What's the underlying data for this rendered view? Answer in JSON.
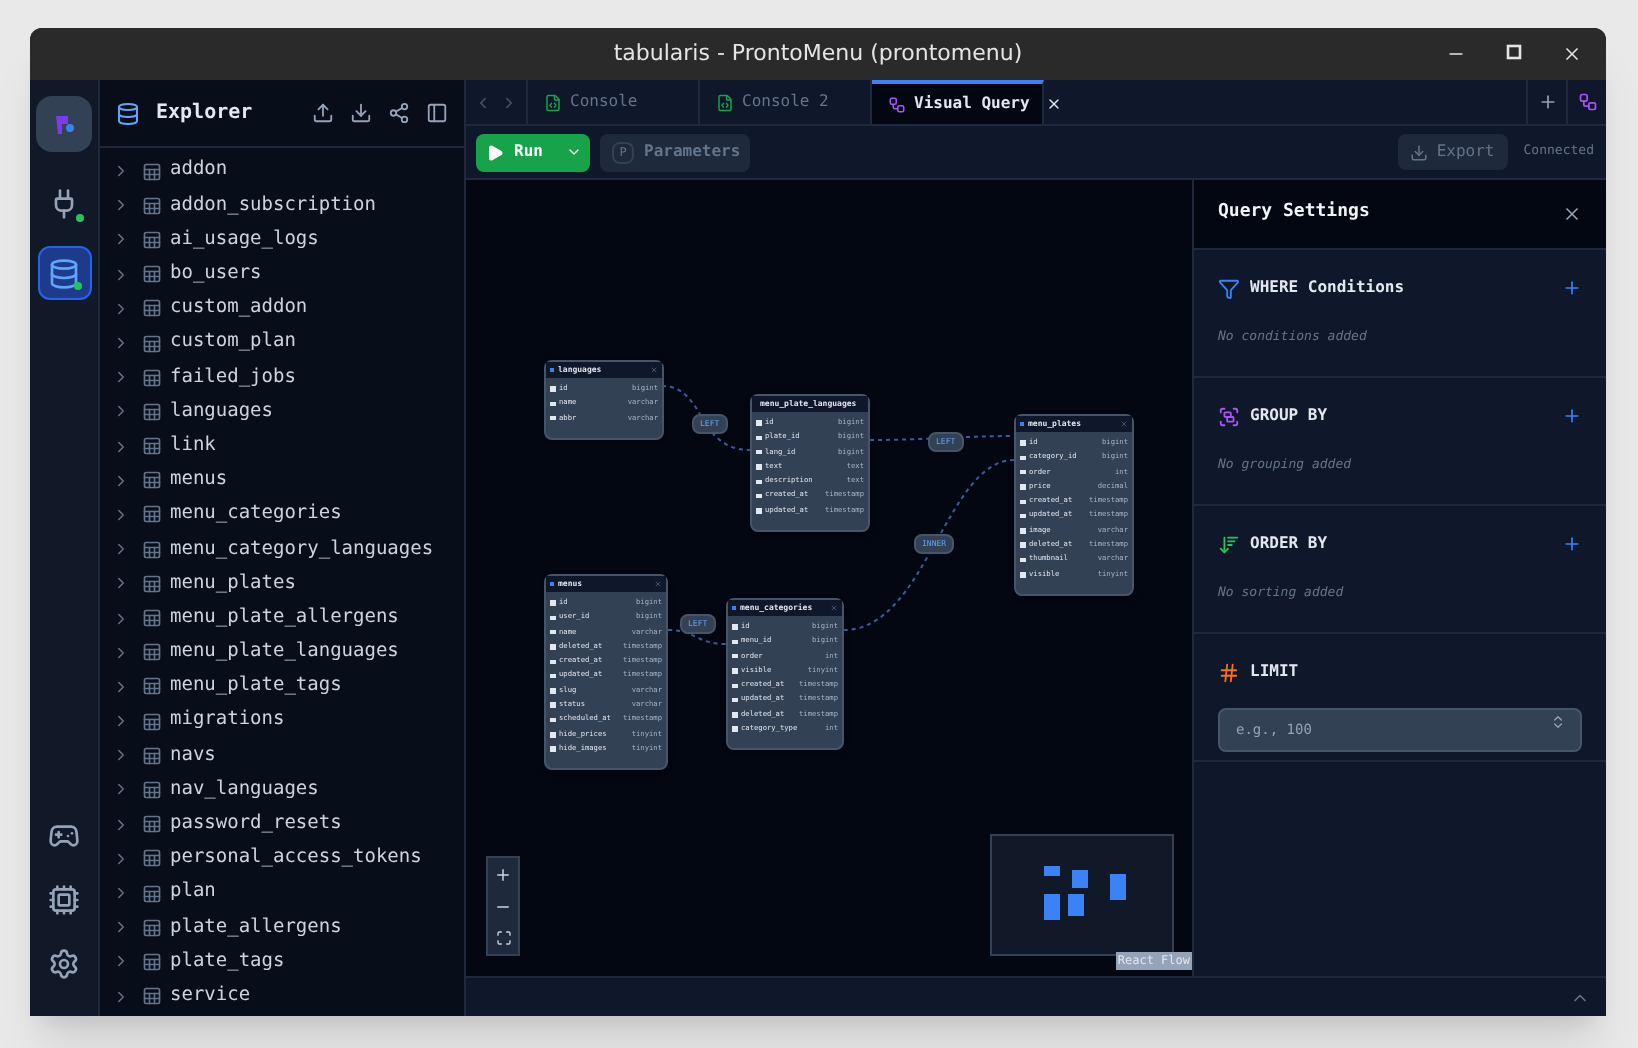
{
  "window": {
    "title": "tabularis - ProntoMenu (prontomenu)"
  },
  "rail": {
    "top": [
      {
        "kind": "connections",
        "selected": false
      },
      {
        "kind": "database",
        "selected": true
      }
    ],
    "bottom": [
      {
        "kind": "discord"
      },
      {
        "kind": "cpu"
      },
      {
        "kind": "settings"
      }
    ]
  },
  "explorer": {
    "title": "Explorer",
    "tables": [
      "addon",
      "addon_subscription",
      "ai_usage_logs",
      "bo_users",
      "custom_addon",
      "custom_plan",
      "failed_jobs",
      "languages",
      "link",
      "menus",
      "menu_categories",
      "menu_category_languages",
      "menu_plates",
      "menu_plate_allergens",
      "menu_plate_languages",
      "menu_plate_tags",
      "migrations",
      "navs",
      "nav_languages",
      "password_resets",
      "personal_access_tokens",
      "plan",
      "plate_allergens",
      "plate_tags",
      "service"
    ]
  },
  "tabs": [
    {
      "label": "Console",
      "kind": "console",
      "selected": false
    },
    {
      "label": "Console 2",
      "kind": "console",
      "selected": false
    },
    {
      "label": "Visual Query",
      "kind": "visual",
      "selected": true
    }
  ],
  "toolbar": {
    "run": "Run",
    "parameters_key": "P",
    "parameters": "Parameters",
    "export": "Export",
    "status": "Connected"
  },
  "diagram": {
    "nodes": [
      {
        "name": "languages",
        "columns": [
          {
            "name": "id",
            "type": "bigint"
          },
          {
            "name": "name",
            "type": "varchar"
          },
          {
            "name": "abbr",
            "type": "varchar"
          }
        ]
      },
      {
        "name": "menu_plate_languages",
        "columns": [
          {
            "name": "id",
            "type": "bigint"
          },
          {
            "name": "plate_id",
            "type": "bigint"
          },
          {
            "name": "lang_id",
            "type": "bigint"
          },
          {
            "name": "text",
            "type": "text"
          },
          {
            "name": "description",
            "type": "text"
          },
          {
            "name": "created_at",
            "type": "timestamp"
          },
          {
            "name": "updated_at",
            "type": "timestamp"
          }
        ]
      },
      {
        "name": "menu_plates",
        "columns": [
          {
            "name": "id",
            "type": "bigint"
          },
          {
            "name": "category_id",
            "type": "bigint"
          },
          {
            "name": "order",
            "type": "int"
          },
          {
            "name": "price",
            "type": "decimal"
          },
          {
            "name": "created_at",
            "type": "timestamp"
          },
          {
            "name": "updated_at",
            "type": "timestamp"
          },
          {
            "name": "image",
            "type": "varchar"
          },
          {
            "name": "deleted_at",
            "type": "timestamp"
          },
          {
            "name": "thumbnail",
            "type": "varchar"
          },
          {
            "name": "visible",
            "type": "tinyint"
          }
        ]
      },
      {
        "name": "menus",
        "columns": [
          {
            "name": "id",
            "type": "bigint"
          },
          {
            "name": "user_id",
            "type": "bigint"
          },
          {
            "name": "name",
            "type": "varchar"
          },
          {
            "name": "deleted_at",
            "type": "timestamp"
          },
          {
            "name": "created_at",
            "type": "timestamp"
          },
          {
            "name": "updated_at",
            "type": "timestamp"
          },
          {
            "name": "slug",
            "type": "varchar"
          },
          {
            "name": "status",
            "type": "varchar"
          },
          {
            "name": "scheduled_at",
            "type": "timestamp"
          },
          {
            "name": "hide_prices",
            "type": "tinyint"
          },
          {
            "name": "hide_images",
            "type": "tinyint"
          }
        ]
      },
      {
        "name": "menu_categories",
        "columns": [
          {
            "name": "id",
            "type": "bigint"
          },
          {
            "name": "menu_id",
            "type": "bigint"
          },
          {
            "name": "order",
            "type": "int"
          },
          {
            "name": "visible",
            "type": "tinyint"
          },
          {
            "name": "created_at",
            "type": "timestamp"
          },
          {
            "name": "updated_at",
            "type": "timestamp"
          },
          {
            "name": "deleted_at",
            "type": "timestamp"
          },
          {
            "name": "category_type",
            "type": "int"
          }
        ]
      }
    ],
    "edges": [
      {
        "label": "LEFT"
      },
      {
        "label": "LEFT"
      },
      {
        "label": "INNER"
      },
      {
        "label": "LEFT"
      }
    ],
    "attribution": "React Flow"
  },
  "query_settings": {
    "title": "Query Settings",
    "sections": [
      {
        "kind": "where",
        "title": "WHERE Conditions",
        "empty": "No conditions added"
      },
      {
        "kind": "group",
        "title": "GROUP BY",
        "empty": "No grouping added"
      },
      {
        "kind": "order",
        "title": "ORDER BY",
        "empty": "No sorting added"
      },
      {
        "kind": "limit",
        "title": "LIMIT",
        "placeholder": "e.g., 100"
      }
    ]
  }
}
